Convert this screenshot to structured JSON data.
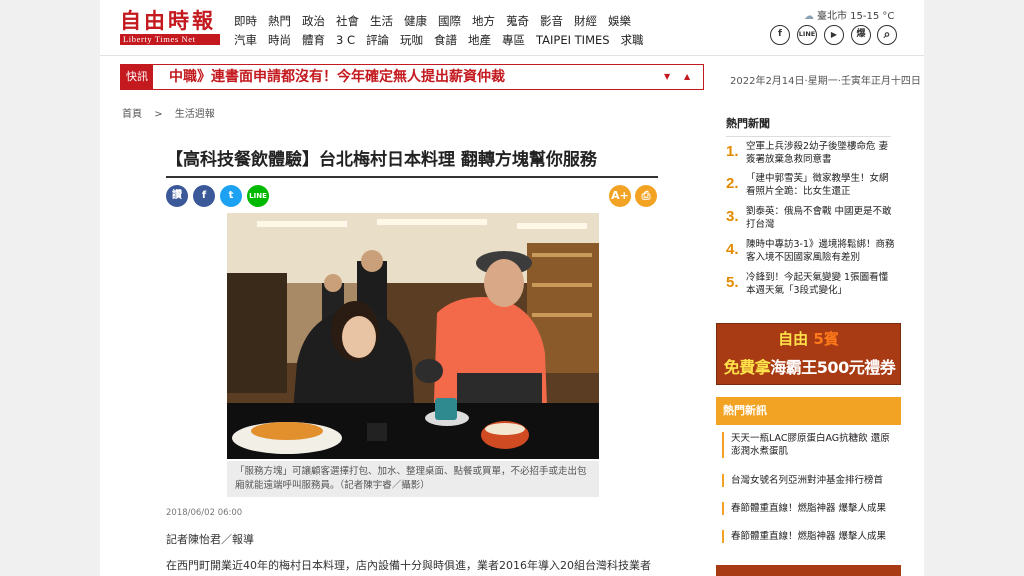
{
  "header": {
    "logo": {
      "zh": "自由時報",
      "en": "Liberty Times Net"
    },
    "nav_row1": [
      "即時",
      "熱門",
      "政治",
      "社會",
      "生活",
      "健康",
      "國際",
      "地方",
      "蒐奇",
      "影音",
      "財經",
      "娛樂"
    ],
    "nav_row2": [
      "汽車",
      "時尚",
      "體育",
      "3 C",
      "評論",
      "玩咖",
      "食譜",
      "地產",
      "專區",
      "TAIPEI TIMES",
      "求職"
    ],
    "weather": "臺北市 15-15 °C",
    "social": {
      "facebook": "f",
      "line": "LINE",
      "youtube": "▶",
      "explode": "爆",
      "search": "⌕"
    }
  },
  "ticker": {
    "tag": "快訊",
    "text": "中職》連書面申請都沒有！今年確定無人提出薪資仲裁",
    "down": "▼",
    "up": "▲"
  },
  "date": "2022年2月14日·星期一·壬寅年正月十四日",
  "breadcrumb": {
    "home": "首頁",
    "sep": ">",
    "section": "生活週報"
  },
  "article": {
    "headline": "【高科技餐飲體驗】台北梅村日本料理 翻轉方塊幫你服務",
    "share": {
      "like": "讚",
      "facebook": "f",
      "twitter": "t",
      "line": "LINE"
    },
    "tools": {
      "font": "A+",
      "print": "⎙"
    },
    "caption": "「服務方塊」可讓顧客選擇打包、加水、整理桌面、點餐或買單，不必招手或走出包廂就能遠端呼叫服務員。（記者陳宇睿／攝影）",
    "timestamp": "2018/06/02 06:00",
    "byline": "記者陳怡君／報導",
    "paragraph": "在西門町開業近40年的梅村日本料理，店內設備十分與時俱進，業者2016年導入20組台灣科技業者"
  },
  "hot_news": {
    "title": "熱門新聞",
    "items": [
      {
        "num": "1.",
        "text": "空軍上兵涉殺2幼子後墜樓命危 妻簽署放棄急救同意書"
      },
      {
        "num": "2.",
        "text": "「建中郭雪芙」徵家教學生！女網看照片全跪：比女生還正"
      },
      {
        "num": "3.",
        "text": "劉泰英：俄烏不會戰 中國更是不敢打台灣"
      },
      {
        "num": "4.",
        "text": "陳時中專訪3-1》邊境將鬆綁！商務客入境不因國家風險有差別"
      },
      {
        "num": "5.",
        "text": "冷鋒到！今起天氣變變 1張圖看懂本週天氣「3段式變化」"
      }
    ]
  },
  "banner": {
    "line1_a": "自由",
    "line1_b": "5賓",
    "line2_a": "免費拿",
    "line2_b": "海霸王500元禮券"
  },
  "hot_flash": {
    "title": "熱門新訊",
    "items": [
      "天天一瓶LAC膠原蛋白AG抗糖飲 還原澎潤水煮蛋肌",
      "台灣女號名列亞洲對沖基金排行榜首",
      "春節體重直線！燃脂神器 爆擊人成果",
      "春節體重直線！燃脂神器 爆擊人成果"
    ]
  },
  "colors": {
    "brand_red": "#c3191f",
    "accent_orange": "#f3a323",
    "facebook": "#3b5998",
    "twitter": "#1da1f2",
    "line": "#00b900"
  }
}
